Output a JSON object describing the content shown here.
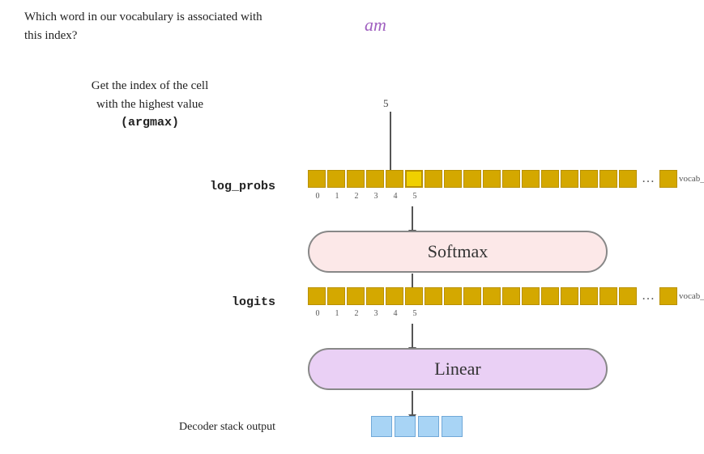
{
  "left": {
    "question": "Which word in our vocabulary\nis associated with this index?",
    "argmax_line1": "Get the index of the cell",
    "argmax_line2": "with the highest value",
    "argmax_keyword": "(argmax)",
    "log_probs_label": "log_probs",
    "logits_label": "logits",
    "decoder_label": "Decoder stack output"
  },
  "diagram": {
    "word": "am",
    "index_number": "5",
    "softmax_label": "Softmax",
    "linear_label": "Linear",
    "index_labels": [
      "0",
      "1",
      "2",
      "3",
      "4",
      "5"
    ],
    "ellipsis": "…",
    "vocab_size": "vocab_size",
    "decoder_cells_count": 4
  },
  "colors": {
    "word_color": "#a060c0",
    "cell_yellow": "#d4a800",
    "cell_blue": "#a8d4f5",
    "softmax_bg": "#fce8e8",
    "linear_bg": "#ead0f5"
  }
}
